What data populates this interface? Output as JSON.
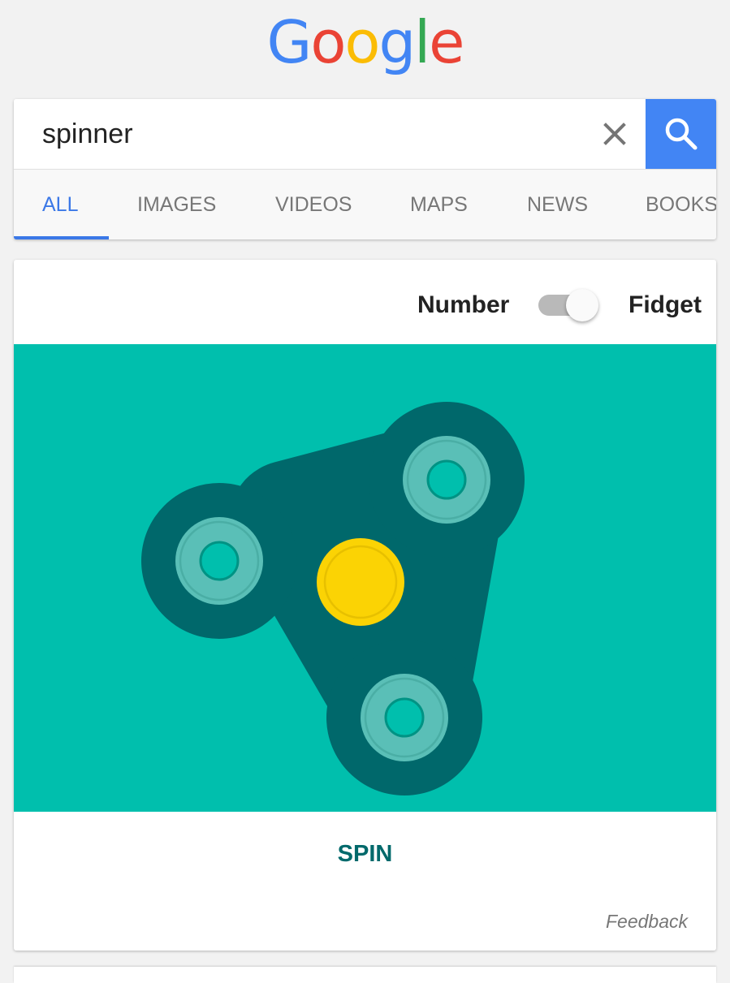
{
  "logo": {
    "text": "Google",
    "letters": [
      {
        "char": "G",
        "color": "#4285F4"
      },
      {
        "char": "o",
        "color": "#EA4335"
      },
      {
        "char": "o",
        "color": "#FBBC05"
      },
      {
        "char": "g",
        "color": "#4285F4"
      },
      {
        "char": "l",
        "color": "#34A853"
      },
      {
        "char": "e",
        "color": "#EA4335"
      }
    ]
  },
  "search": {
    "query": "spinner",
    "clear_icon": "close-icon",
    "submit_icon": "search-icon",
    "accent": "#4285F4"
  },
  "tabs": [
    {
      "label": "ALL",
      "active": true
    },
    {
      "label": "IMAGES",
      "active": false
    },
    {
      "label": "VIDEOS",
      "active": false
    },
    {
      "label": "MAPS",
      "active": false
    },
    {
      "label": "NEWS",
      "active": false
    },
    {
      "label": "BOOKS",
      "active": false
    }
  ],
  "spinner_widget": {
    "toggle_left_label": "Number",
    "toggle_right_label": "Fidget",
    "toggle_state": "Fidget",
    "spin_label": "SPIN",
    "feedback_label": "Feedback",
    "colors": {
      "background": "#00BFAD",
      "body": "#00686B",
      "bearing_outer": "#5ABFB7",
      "center_cap": "#FBD304"
    }
  }
}
